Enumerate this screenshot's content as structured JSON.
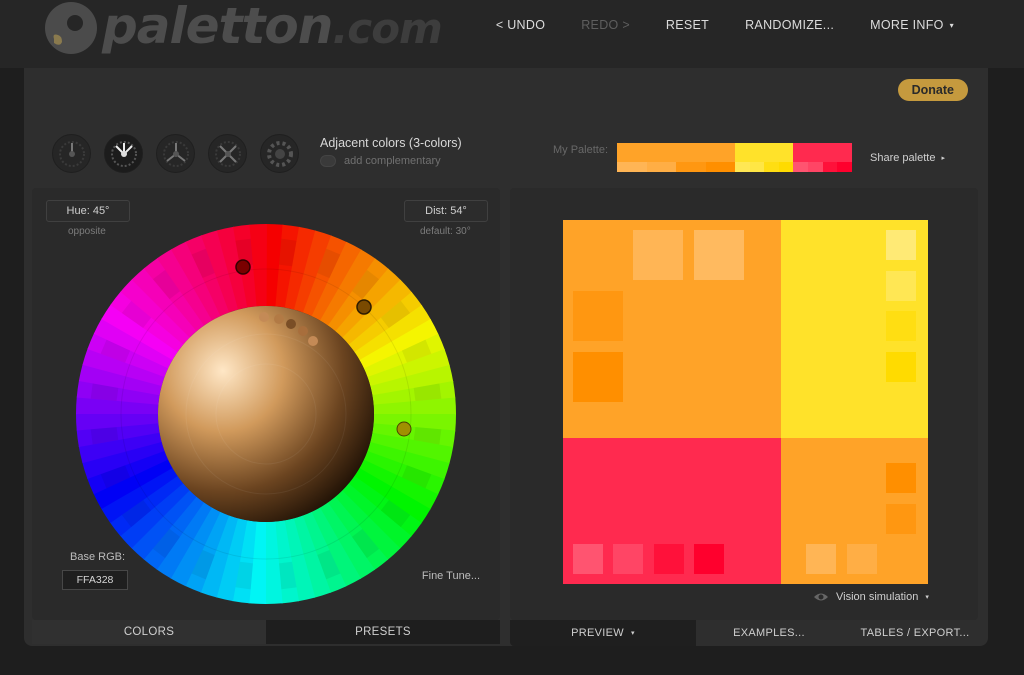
{
  "logo": {
    "brand": "paletton",
    "tld": ".com"
  },
  "nav": {
    "undo": "< UNDO",
    "redo": "REDO >",
    "reset": "RESET",
    "randomize": "RANDOMIZE...",
    "more_info": "MORE INFO",
    "more_caret": "▾"
  },
  "donate": "Donate",
  "scheme": {
    "title": "Adjacent colors (3-colors)",
    "complementary": "add complementary",
    "icons": [
      "mono-scheme-icon",
      "adjacent-scheme-icon",
      "triad-scheme-icon",
      "tetrad-scheme-icon",
      "free-style-icon"
    ]
  },
  "wheel": {
    "hue_label": "Hue: 45°",
    "hue_note": "opposite",
    "dist_label": "Dist: 54°",
    "dist_note": "default: 30°",
    "base_rgb_label": "Base RGB:",
    "base_rgb": "FFA328",
    "fine_tune": "Fine Tune..."
  },
  "left_tabs": {
    "colors": "COLORS",
    "presets": "PRESETS"
  },
  "palette": {
    "label": "My Palette:",
    "share": "Share palette",
    "share_caret": "▸",
    "colors": {
      "primary": "#FFA328",
      "secondary_yellow": "#FFE22A",
      "secondary_red": "#FF2A4F"
    }
  },
  "preview": {
    "vision": "Vision simulation",
    "vision_caret": "▾"
  },
  "right_tabs": {
    "preview": "PREVIEW",
    "preview_caret": "▾",
    "examples": "EXAMPLES...",
    "tables": "TABLES / EXPORT..."
  }
}
